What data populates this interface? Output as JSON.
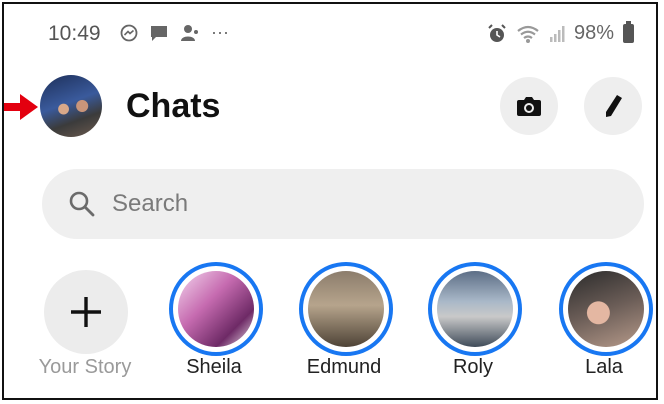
{
  "status_bar": {
    "time": "10:49",
    "more": "···",
    "battery": "98%"
  },
  "header": {
    "title": "Chats"
  },
  "search": {
    "placeholder": "Search"
  },
  "stories": [
    {
      "label": "Your Story"
    },
    {
      "label": "Sheila"
    },
    {
      "label": "Edmund"
    },
    {
      "label": "Roly"
    },
    {
      "label": "Lala"
    }
  ],
  "colors": {
    "story_ring": "#1877f2",
    "annotation_arrow": "#e3000f"
  }
}
